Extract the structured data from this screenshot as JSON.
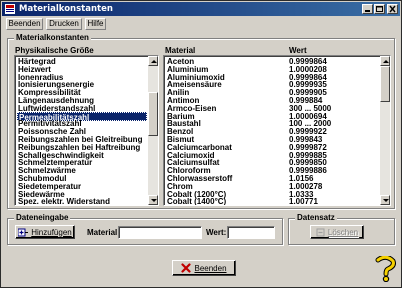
{
  "window": {
    "title": "Materialkonstanten"
  },
  "menu": {
    "items": [
      "Beenden",
      "Drucken",
      "Hilfe"
    ]
  },
  "main_group": {
    "label": "Materialkonstanten",
    "left_header": "Physikalische Größe",
    "material_header": "Material",
    "value_header": "Wert",
    "quantities": [
      "Härtegrad",
      "Heizwert",
      "Ionenradius",
      "Ionisierungsenergie",
      "Kompressibilität",
      "Längenausdehnung",
      "Luftwiderstandszahl",
      "Permeabilitätszahl",
      "Permitivitätszahl",
      "Poissonsche Zahl",
      "Reibungszahlen bei Gleitreibung",
      "Reibungszahlen bei Haftreibung",
      "Schallgeschwindigkeit",
      "Schmelztemperatur",
      "Schmelzwärme",
      "Schubmodul",
      "Siedetemperatur",
      "Siedewärme",
      "Spez. elektr. Widerstand"
    ],
    "selected_quantity": "Permeabilitätszahl",
    "materials": [
      {
        "name": "Aceton",
        "value": "0.9999864"
      },
      {
        "name": "Aluminium",
        "value": "1.0000208"
      },
      {
        "name": "Aluminiumoxid",
        "value": "0.9999864"
      },
      {
        "name": "Ameisensäure",
        "value": "0.9999935"
      },
      {
        "name": "Anilin",
        "value": "0.9999905"
      },
      {
        "name": "Antimon",
        "value": "0.999884"
      },
      {
        "name": "Armco-Eisen",
        "value": "300 ... 5000"
      },
      {
        "name": "Barium",
        "value": "1.0000694"
      },
      {
        "name": "Baustahl",
        "value": "100 ... 2000"
      },
      {
        "name": "Benzol",
        "value": "0.9999922"
      },
      {
        "name": "Bismut",
        "value": "0.999843"
      },
      {
        "name": "Calciumcarbonat",
        "value": "0.9999872"
      },
      {
        "name": "Calciumoxid",
        "value": "0.9999885"
      },
      {
        "name": "Calciumsulfat",
        "value": "0.9999850"
      },
      {
        "name": "Chloroform",
        "value": "0.9999886"
      },
      {
        "name": "Chlorwasserstoff",
        "value": "1.0156"
      },
      {
        "name": "Chrom",
        "value": "1.000278"
      },
      {
        "name": "Cobalt (1200°C)",
        "value": "1.0333"
      },
      {
        "name": "Cobalt (1400°C)",
        "value": "1.00771"
      }
    ]
  },
  "input_group": {
    "label": "Dateneingabe",
    "add_button": "Hinzufügen",
    "material_label": "Material:",
    "value_label": "Wert:",
    "material_value": "",
    "value_value": ""
  },
  "record_group": {
    "label": "Datensatz",
    "delete_button": "Löschen"
  },
  "footer": {
    "close_button": "Beenden"
  }
}
